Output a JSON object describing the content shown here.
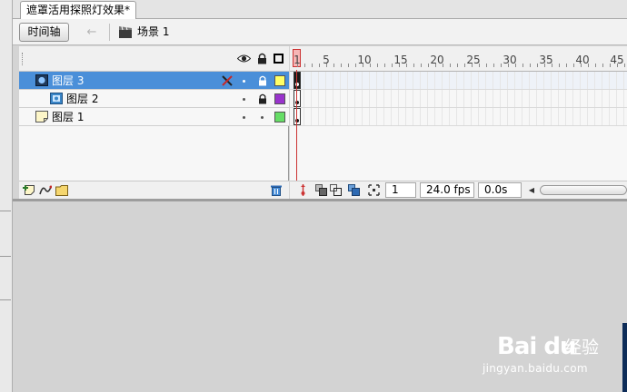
{
  "document": {
    "tab_title": "遮罩活用探照灯效果*"
  },
  "toolbar": {
    "timeline_label": "时间轴",
    "back_arrow": "←",
    "scene_label": "场景 1"
  },
  "layers": [
    {
      "name": "图层 3",
      "selected": true,
      "type": "mask",
      "outline_color": "#ffff66"
    },
    {
      "name": "图层 2",
      "selected": false,
      "type": "masked",
      "outline_color": "#9933cc"
    },
    {
      "name": "图层 1",
      "selected": false,
      "type": "normal",
      "outline_color": "#66dd66"
    }
  ],
  "ruler": {
    "labels": [
      "1",
      "5",
      "10",
      "15",
      "20",
      "25",
      "30",
      "35",
      "40",
      "45"
    ]
  },
  "frames_footer": {
    "current_frame": "1",
    "fps": "24.0 fps",
    "elapsed": "0.0s",
    "scroll_left": "◀"
  },
  "watermark": {
    "logo": "Bai du",
    "text": "经验",
    "url": "jingyan.baidu.com"
  },
  "icons": {
    "eye": "eye-icon",
    "lock": "lock-icon",
    "outline": "outline-icon",
    "pencil": "pencil-icon",
    "scene": "scene-icon",
    "add_layer": "add-layer-icon",
    "motion_guide": "add-motion-guide-icon",
    "folder": "new-folder-icon",
    "trash": "trash-icon",
    "center_frame": "center-frame-icon",
    "onion_skin": "onion-skin-icon",
    "onion_outline": "onion-skin-outline-icon",
    "edit_multiple": "edit-multiple-frames-icon",
    "modify_markers": "modify-onion-markers-icon"
  },
  "colors": {
    "selection": "#4a8fd9",
    "playhead": "#cc3333",
    "stage": "#d3d3d3"
  }
}
